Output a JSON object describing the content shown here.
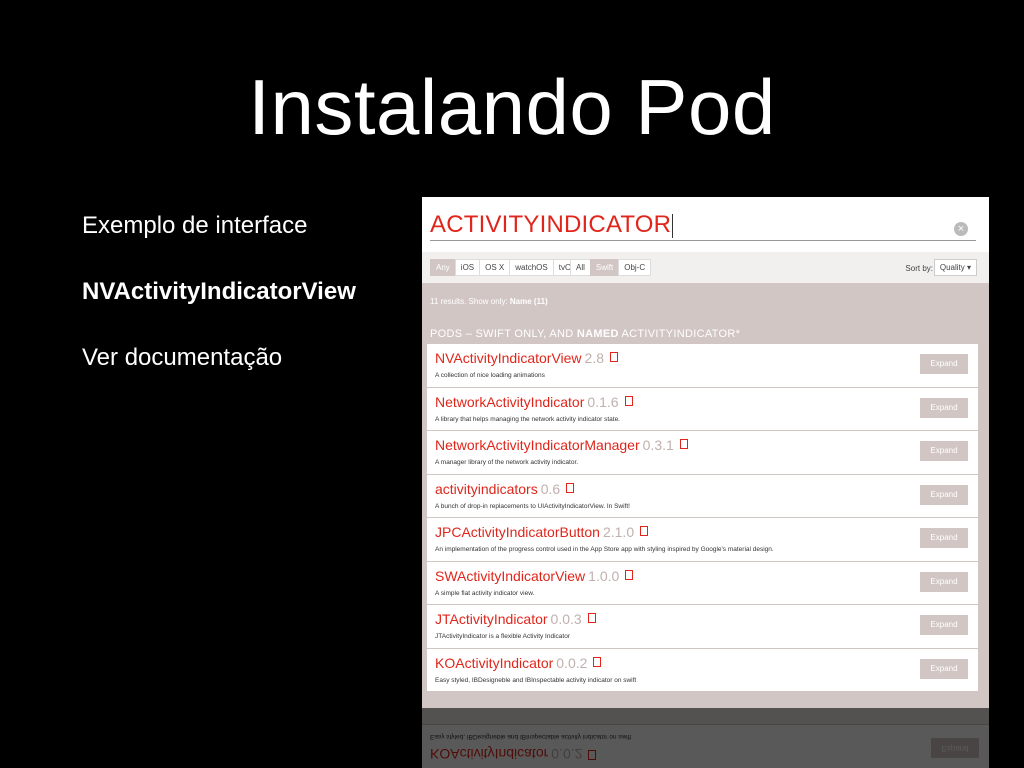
{
  "slide": {
    "title": "Instalando Pod",
    "bullets": [
      "Exemplo de interface",
      "NVActivityIndicatorView",
      "Ver documentação"
    ]
  },
  "search": {
    "value": "ACTIVITYINDICATOR",
    "clear_icon": "close-circle-icon"
  },
  "filters": {
    "platforms": [
      "Any",
      "iOS",
      "OS X",
      "watchOS",
      "tvOS"
    ],
    "platform_selected": "Any",
    "languages": [
      "All",
      "Swift",
      "Obj-C"
    ],
    "language_selected": "Swift",
    "sort_label": "Sort by:",
    "sort_value": "Quality ▾"
  },
  "results": {
    "count_text": "11 results.  Show only:",
    "count_filter": "Name (11)",
    "section_prefix": "PODS – SWIFT ONLY, AND ",
    "section_bold": "NAMED",
    "section_suffix": " ACTIVITYINDICATOR*",
    "expand_label": "Expand",
    "items": [
      {
        "name": "NVActivityIndicatorView",
        "version": "2.8",
        "desc": "A collection of nice loading animations"
      },
      {
        "name": "NetworkActivityIndicator",
        "version": "0.1.6",
        "desc": "A library that helps managing the network activity indicator state."
      },
      {
        "name": "NetworkActivityIndicatorManager",
        "version": "0.3.1",
        "desc": "A manager library of the network activity indicator."
      },
      {
        "name": "activityindicators",
        "version": "0.6",
        "desc": "A bunch of drop-in replacements to UIActivityIndicatorView. In Swift!"
      },
      {
        "name": "JPCActivityIndicatorButton",
        "version": "2.1.0",
        "desc": "An implementation of the progress control used in the App Store app with styling inspired by Google's material design."
      },
      {
        "name": "SWActivityIndicatorView",
        "version": "1.0.0",
        "desc": "A simple flat activity indicator view."
      },
      {
        "name": "JTActivityIndicator",
        "version": "0.0.3",
        "desc": "JTActivityIndicator is a flexible Activity Indicator"
      },
      {
        "name": "KOActivityIndicator",
        "version": "0.0.2",
        "desc": "Easy styled, IBDesigneble and IBInspectable activity indicator on swift"
      }
    ]
  },
  "colors": {
    "accent": "#e0261b",
    "muted": "#d2c6c4",
    "background": "#000000"
  }
}
